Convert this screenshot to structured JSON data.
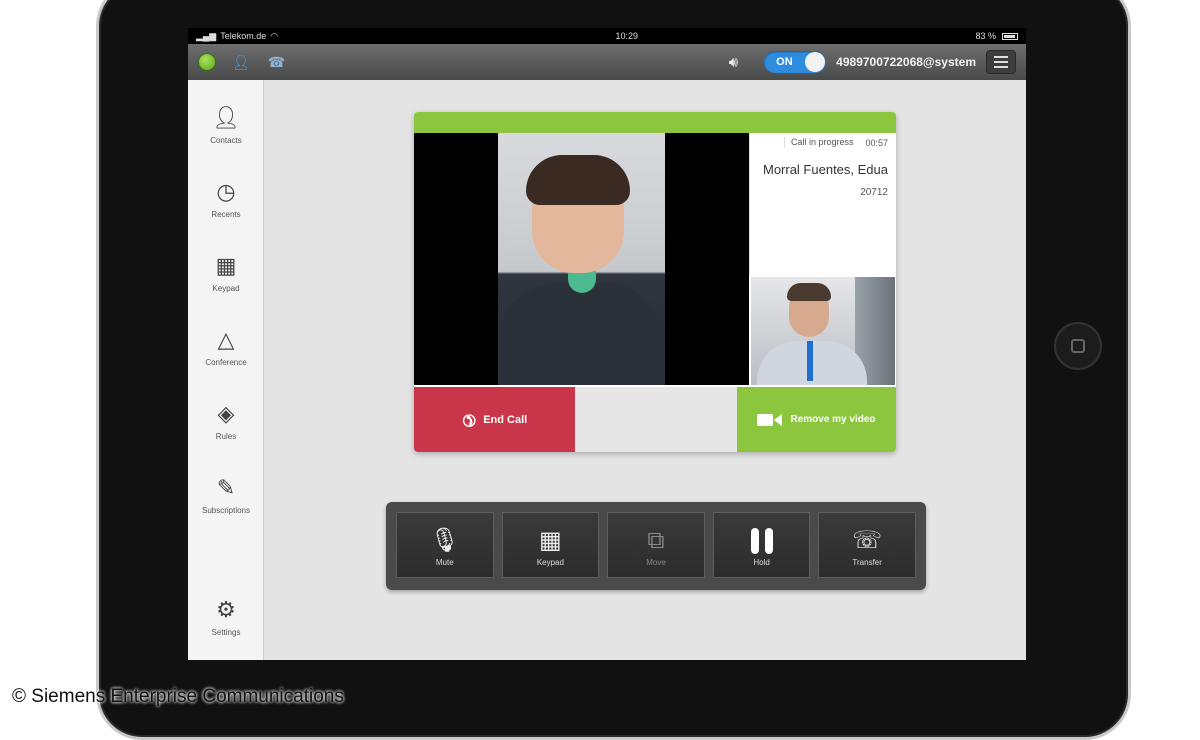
{
  "status_bar": {
    "carrier": "Telekom.de",
    "time": "10:29",
    "battery": "83 %"
  },
  "app_header": {
    "presence_color": "#6ab82a",
    "toggle_label": "ON",
    "account": "4989700722068@system",
    "icons": [
      "presence-status-icon",
      "user-icon",
      "device-icon",
      "speaker-icon",
      "menu-icon"
    ]
  },
  "sidebar": {
    "items": [
      {
        "label": "Contacts",
        "icon": "person-icon"
      },
      {
        "label": "Recents",
        "icon": "clock-icon"
      },
      {
        "label": "Keypad",
        "icon": "keypad-icon"
      },
      {
        "label": "Conference",
        "icon": "conference-icon"
      },
      {
        "label": "Rules",
        "icon": "rules-icon"
      },
      {
        "label": "Subscriptions",
        "icon": "subscriptions-icon"
      },
      {
        "label": "Settings",
        "icon": "gears-icon"
      }
    ]
  },
  "call": {
    "status_label": "Call in progress",
    "duration": "00:57",
    "name": "Morral Fuentes, Edua",
    "number": "20712",
    "end_call_label": "End Call",
    "remove_video_label": "Remove my video",
    "colors": {
      "accent": "#8cc63f",
      "end_call": "#c9364a"
    }
  },
  "controls": [
    {
      "label": "Mute",
      "icon": "microphone-icon",
      "enabled": true
    },
    {
      "label": "Keypad",
      "icon": "keypad-icon",
      "enabled": true
    },
    {
      "label": "Move",
      "icon": "move-icon",
      "enabled": false
    },
    {
      "label": "Hold",
      "icon": "pause-icon",
      "enabled": true
    },
    {
      "label": "Transfer",
      "icon": "transfer-icon",
      "enabled": true
    }
  ],
  "copyright": "© Siemens Enterprise Communications"
}
